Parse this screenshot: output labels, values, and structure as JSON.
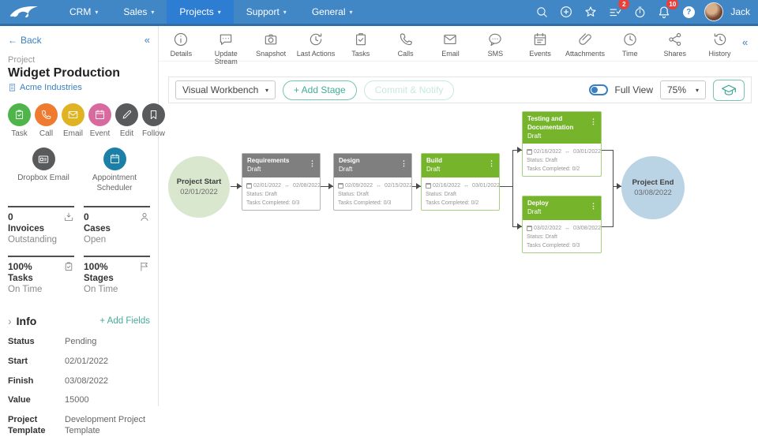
{
  "colors": {
    "nav_blue": "#4186c5",
    "nav_active_blue": "#2d7dd2",
    "badge_red": "#e8413c",
    "accent_teal": "#45ab97",
    "link_blue": "#3a7fc1",
    "stage_green": "#76b42c",
    "stage_gray": "#7f7f7f",
    "start_circle_green": "#d9e7cf",
    "end_circle_blue": "#bad3e5",
    "action_task_green": "#4fb54a",
    "action_call_orange": "#ee7b30",
    "action_email_gold": "#e0b322",
    "action_event_pink": "#d96a9f",
    "action_dark_gray": "#595a5c",
    "action_scheduler_teal": "#1c7fa7"
  },
  "nav": {
    "items": [
      {
        "label": "CRM"
      },
      {
        "label": "Sales"
      },
      {
        "label": "Projects"
      },
      {
        "label": "Support"
      },
      {
        "label": "General"
      }
    ],
    "active_item": "Projects",
    "checklist_badge": "2",
    "bell_badge": "10",
    "user_name": "Jack"
  },
  "toolbar": {
    "items": [
      {
        "label": "Details",
        "icon": "info-icon"
      },
      {
        "label": "Update Stream",
        "icon": "chat-icon"
      },
      {
        "label": "Snapshot",
        "icon": "camera-icon"
      },
      {
        "label": "Last Actions",
        "icon": "recent-icon"
      },
      {
        "label": "Tasks",
        "icon": "clipboard-check-icon"
      },
      {
        "label": "Calls",
        "icon": "phone-icon"
      },
      {
        "label": "Email",
        "icon": "envelope-icon"
      },
      {
        "label": "SMS",
        "icon": "sms-icon"
      },
      {
        "label": "Events",
        "icon": "calendar-icon"
      },
      {
        "label": "Attachments",
        "icon": "paperclip-icon"
      },
      {
        "label": "Time",
        "icon": "clock-icon"
      },
      {
        "label": "Shares",
        "icon": "share-icon"
      },
      {
        "label": "History",
        "icon": "history-icon"
      }
    ]
  },
  "left_panel": {
    "back_label": "Back",
    "record_type": "Project",
    "title": "Widget Production",
    "account": "Acme Industries",
    "actions": [
      {
        "label": "Task",
        "icon": "clipboard-check-icon"
      },
      {
        "label": "Call",
        "icon": "phone-icon"
      },
      {
        "label": "Email",
        "icon": "envelope-icon"
      },
      {
        "label": "Event",
        "icon": "calendar-icon"
      },
      {
        "label": "Edit",
        "icon": "pencil-icon"
      },
      {
        "label": "Follow",
        "icon": "bookmark-icon"
      }
    ],
    "secondary_actions": [
      {
        "label": "Dropbox Email",
        "icon": "mail-card-icon"
      },
      {
        "label": "Appointment Scheduler",
        "icon": "calendar-icon"
      }
    ],
    "stats": [
      {
        "value": "0",
        "label": "Invoices",
        "sublabel": "Outstanding",
        "icon": "invoice-tray-icon"
      },
      {
        "value": "0",
        "label": "Cases",
        "sublabel": "Open",
        "icon": "person-icon"
      },
      {
        "value": "100%",
        "label": "Tasks",
        "sublabel": "On Time",
        "icon": "clipboard-check-icon"
      },
      {
        "value": "100%",
        "label": "Stages",
        "sublabel": "On Time",
        "icon": "flag-icon"
      }
    ],
    "info": {
      "title": "Info",
      "add_fields_label": "+ Add Fields",
      "fields": [
        {
          "label": "Status",
          "value": "Pending"
        },
        {
          "label": "Start",
          "value": "02/01/2022"
        },
        {
          "label": "Finish",
          "value": "03/08/2022"
        },
        {
          "label": "Value",
          "value": "15000"
        },
        {
          "label": "Project Template",
          "value": "Development Project Template"
        }
      ]
    }
  },
  "workbench": {
    "view_selector_value": "Visual Workbench",
    "add_stage_label": "+ Add Stage",
    "commit_label": "Commit & Notify",
    "full_view_label": "Full View",
    "zoom_value": "75%"
  },
  "flow": {
    "start": {
      "title": "Project Start",
      "date": "02/01/2022"
    },
    "end": {
      "title": "Project End",
      "date": "03/08/2022"
    },
    "stages": [
      {
        "name": "Requirements",
        "status": "Draft",
        "date_start": "02/01/2022",
        "date_end": "02/08/2022",
        "status_line": "Status: Draft",
        "tasks_line": "Tasks Completed: 0/3",
        "color": "gray"
      },
      {
        "name": "Design",
        "status": "Draft",
        "date_start": "02/09/2022",
        "date_end": "02/15/2022",
        "status_line": "Status: Draft",
        "tasks_line": "Tasks Completed: 0/3",
        "color": "gray"
      },
      {
        "name": "Build",
        "status": "Draft",
        "date_start": "02/16/2022",
        "date_end": "03/01/2022",
        "status_line": "Status: Draft",
        "tasks_line": "Tasks Completed: 0/2",
        "color": "green"
      },
      {
        "name": "Testing and Documentation",
        "status": "Draft",
        "date_start": "02/16/2022",
        "date_end": "03/01/2022",
        "status_line": "Status: Draft",
        "tasks_line": "Tasks Completed: 0/2",
        "color": "green"
      },
      {
        "name": "Deploy",
        "status": "Draft",
        "date_start": "03/02/2022",
        "date_end": "03/08/2022",
        "status_line": "Status: Draft",
        "tasks_line": "Tasks Completed: 0/3",
        "color": "green"
      }
    ]
  }
}
